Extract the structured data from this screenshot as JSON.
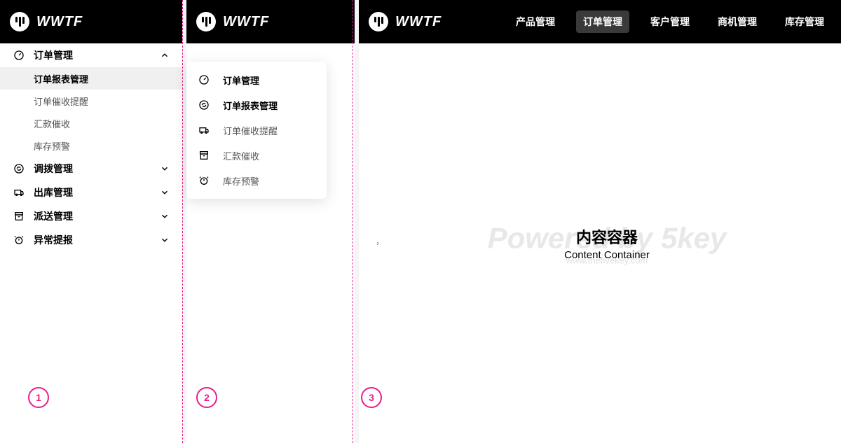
{
  "brand": "WWTF",
  "topnav": {
    "items": [
      "产品管理",
      "订单管理",
      "客户管理",
      "商机管理",
      "库存管理"
    ],
    "active_index": 1
  },
  "sidebar": {
    "groups": [
      {
        "label": "订单管理",
        "expanded": true,
        "children": [
          "订单报表管理",
          "订单催收提醒",
          "汇款催收",
          "库存预警"
        ],
        "active_child": 0
      },
      {
        "label": "调拨管理",
        "expanded": false
      },
      {
        "label": "出库管理",
        "expanded": false
      },
      {
        "label": "派送管理",
        "expanded": false
      },
      {
        "label": "异常提报",
        "expanded": false
      }
    ]
  },
  "float_menu": {
    "header": "订单管理",
    "items": [
      "订单报表管理",
      "订单催收提醒",
      "汇款催收",
      "库存预警"
    ],
    "selected": 0
  },
  "content": {
    "title": "内容容器",
    "subtitle": "Content Container"
  },
  "watermark": {
    "big": "Powered by 5key",
    "small": "www.thefivekey.com"
  },
  "badges": [
    "1",
    "2",
    "3"
  ]
}
